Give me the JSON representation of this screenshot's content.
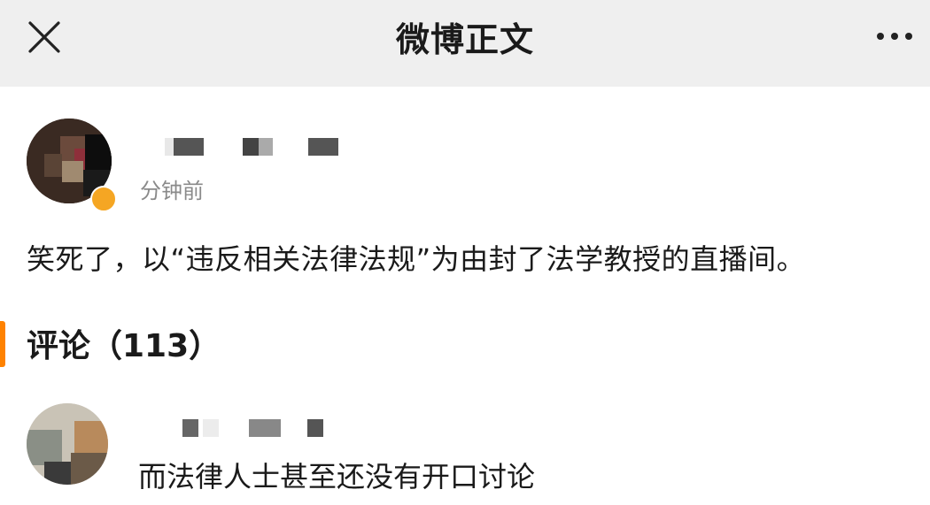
{
  "header": {
    "title": "微博正文",
    "close_icon": "close-icon",
    "more_icon": "more-horizontal-icon"
  },
  "post": {
    "time": "分钟前",
    "text": "笑死了，以“违反相关法律法规”为由封了法学教授的直播间。"
  },
  "comments": {
    "header": "评论（113）",
    "items": [
      {
        "text": "而法律人士甚至还没有开口讨论"
      }
    ]
  },
  "colors": {
    "topbar_bg": "#efefef",
    "accent": "#ff8200",
    "vip_badge": "#f5a623",
    "time_text": "#8a8a8a"
  }
}
